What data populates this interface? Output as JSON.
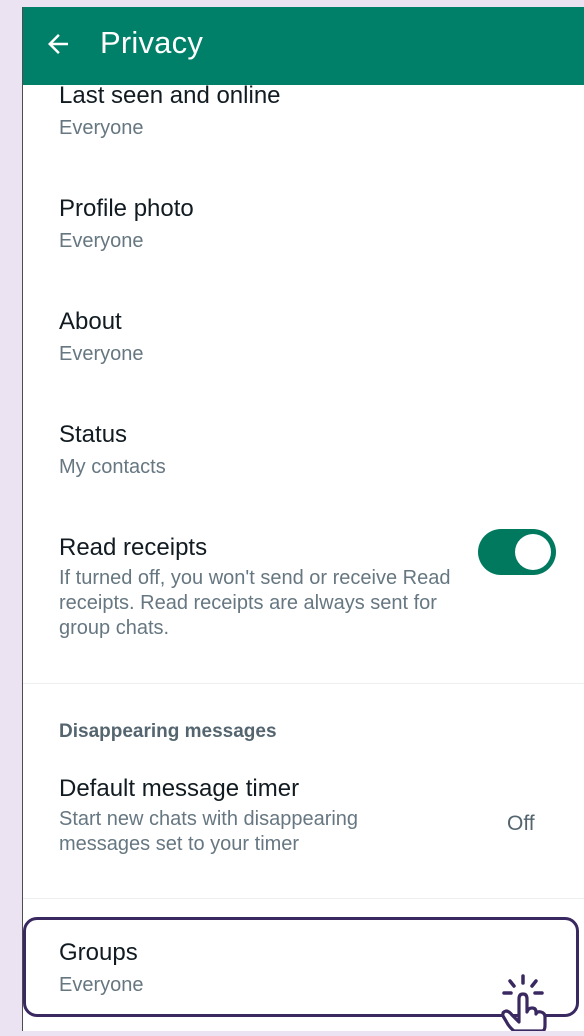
{
  "appbar": {
    "title": "Privacy",
    "back_icon": "arrow-left-icon",
    "color": "#008069"
  },
  "items": {
    "last_seen": {
      "title": "Last seen and online",
      "value": "Everyone"
    },
    "profile_photo": {
      "title": "Profile photo",
      "value": "Everyone"
    },
    "about": {
      "title": "About",
      "value": "Everyone"
    },
    "status": {
      "title": "Status",
      "value": "My contacts"
    },
    "read_receipts": {
      "title": "Read receipts",
      "description": "If turned off, you won't send or receive Read receipts. Read receipts are always sent for group chats.",
      "enabled": true
    }
  },
  "disappearing": {
    "section_title": "Disappearing messages",
    "default_timer": {
      "title": "Default message timer",
      "description": "Start new chats with disappearing messages set to your timer",
      "value": "Off"
    }
  },
  "groups": {
    "title": "Groups",
    "value": "Everyone"
  },
  "accent": "#00795e",
  "highlight_color": "#3a2860"
}
